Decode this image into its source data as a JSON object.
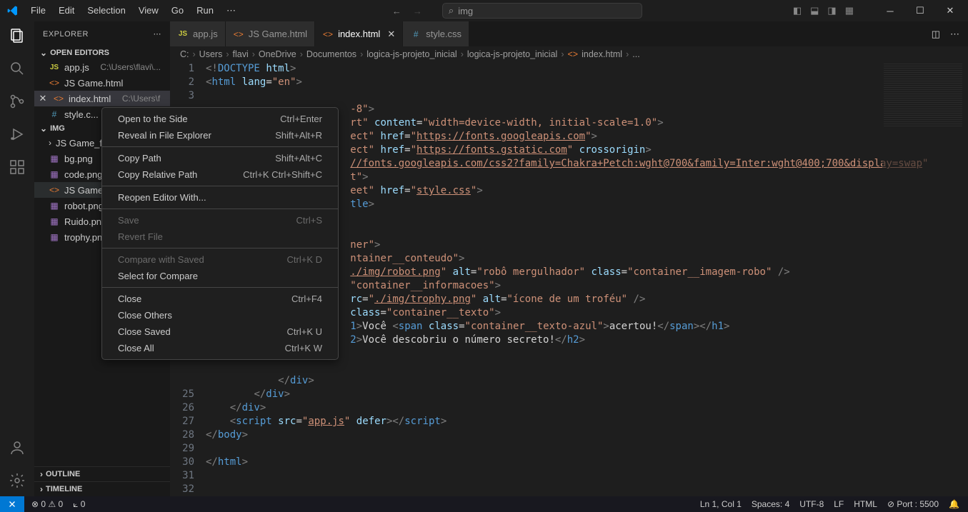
{
  "menubar": [
    "File",
    "Edit",
    "Selection",
    "View",
    "Go",
    "Run",
    "⋯"
  ],
  "search": {
    "placeholder": "img",
    "icon": "search-icon"
  },
  "explorer": {
    "title": "EXPLORER",
    "openEditors": "OPEN EDITORS",
    "folder": "IMG",
    "outline": "OUTLINE",
    "timeline": "TIMELINE",
    "editors": [
      {
        "icon": "JS",
        "name": "app.js",
        "path": "C:\\Users\\flavi\\..."
      },
      {
        "icon": "<>",
        "name": "JS Game.html",
        "path": ""
      },
      {
        "icon": "<>",
        "name": "index.html",
        "path": "C:\\Users\\f",
        "active": true
      },
      {
        "icon": "#",
        "name": "style.c...",
        "path": ""
      }
    ],
    "files": [
      {
        "type": "folder",
        "name": "JS Game_fil..."
      },
      {
        "type": "img",
        "name": "bg.png"
      },
      {
        "type": "img",
        "name": "code.png"
      },
      {
        "type": "html",
        "name": "JS Game.ht...",
        "hl": true
      },
      {
        "type": "img",
        "name": "robot.png"
      },
      {
        "type": "img",
        "name": "Ruido.png"
      },
      {
        "type": "img",
        "name": "trophy.png"
      }
    ]
  },
  "tabs": [
    {
      "icon": "JS",
      "label": "app.js"
    },
    {
      "icon": "<>",
      "label": "JS Game.html"
    },
    {
      "icon": "<>",
      "label": "index.html",
      "active": true,
      "close": true
    },
    {
      "icon": "#",
      "label": "style.css"
    }
  ],
  "breadcrumb": [
    "C:",
    "Users",
    "flavi",
    "OneDrive",
    "Documentos",
    "logica-js-projeto_inicial",
    "logica-js-projeto_inicial",
    "index.html",
    "..."
  ],
  "context_menu": [
    {
      "label": "Open to the Side",
      "key": "Ctrl+Enter"
    },
    {
      "label": "Reveal in File Explorer",
      "key": "Shift+Alt+R"
    },
    {
      "sep": true
    },
    {
      "label": "Copy Path",
      "key": "Shift+Alt+C"
    },
    {
      "label": "Copy Relative Path",
      "key": "Ctrl+K Ctrl+Shift+C"
    },
    {
      "sep": true
    },
    {
      "label": "Reopen Editor With..."
    },
    {
      "sep": true
    },
    {
      "label": "Save",
      "key": "Ctrl+S",
      "disabled": true
    },
    {
      "label": "Revert File",
      "disabled": true
    },
    {
      "sep": true
    },
    {
      "label": "Compare with Saved",
      "key": "Ctrl+K D",
      "disabled": true
    },
    {
      "label": "Select for Compare"
    },
    {
      "sep": true
    },
    {
      "label": "Close",
      "key": "Ctrl+F4"
    },
    {
      "label": "Close Others"
    },
    {
      "label": "Close Saved",
      "key": "Ctrl+K U"
    },
    {
      "label": "Close All",
      "key": "Ctrl+K W"
    }
  ],
  "statusbar": {
    "errors": "0",
    "warnings": "0",
    "port_i": "0",
    "ln": "Ln 1, Col 1",
    "spaces": "Spaces: 4",
    "enc": "UTF-8",
    "eol": "LF",
    "lang": "HTML",
    "port": "Port : 5500"
  },
  "code_lines": [
    "1",
    "2",
    "3",
    "",
    "",
    "",
    "",
    "",
    "",
    "",
    "",
    "",
    "",
    "",
    "",
    "",
    "",
    "",
    "",
    "",
    "",
    "",
    "",
    "",
    "25",
    "26",
    "27",
    "28",
    "29",
    "30",
    "31",
    "32"
  ]
}
